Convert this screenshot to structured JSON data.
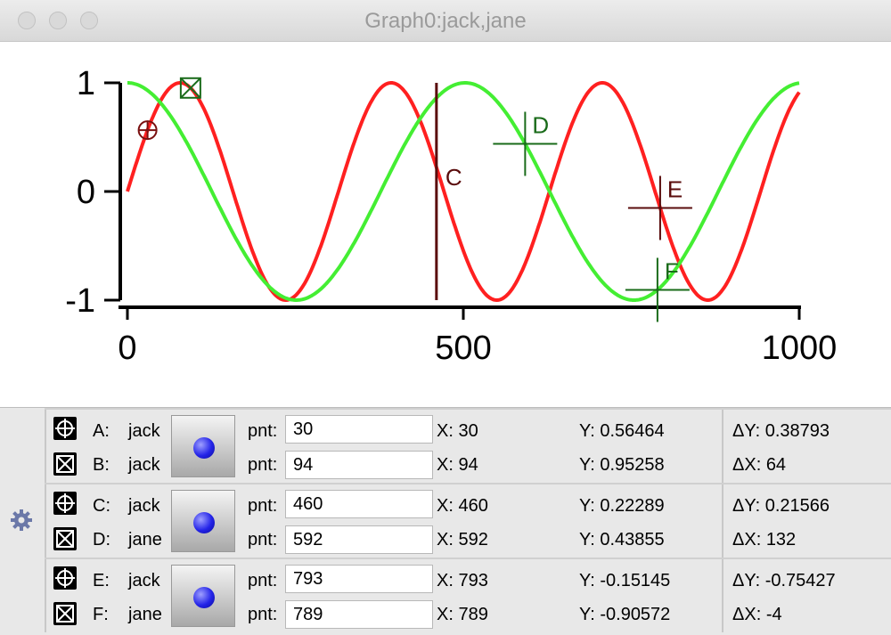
{
  "window": {
    "title": "Graph0:jack,jane"
  },
  "chart_data": {
    "type": "line",
    "x_range": [
      0,
      1000
    ],
    "y_range": [
      -1,
      1
    ],
    "x_ticks": [
      "0",
      "500",
      "1000"
    ],
    "y_ticks": [
      "1",
      "0",
      "-1"
    ],
    "series": [
      {
        "name": "jack",
        "function": "sin",
        "period": 314.16,
        "color": "#ff2020"
      },
      {
        "name": "jane",
        "function": "cos",
        "period": 502.65,
        "color": "#44ee33"
      }
    ],
    "cursors": [
      {
        "label": "A",
        "x": 30,
        "y": 0.56464,
        "style": "circle-cross",
        "color": "#7a1010"
      },
      {
        "label": "B",
        "x": 94,
        "y": 0.95258,
        "style": "box-cross",
        "color": "#1a6b1a"
      },
      {
        "label": "C",
        "x": 460,
        "y": 0.22289,
        "style": "vertical-line",
        "color": "#5a0c0c"
      },
      {
        "label": "D",
        "x": 592,
        "y": 0.43855,
        "style": "crosshair",
        "color": "#1a6b1a"
      },
      {
        "label": "E",
        "x": 793,
        "y": -0.15145,
        "style": "crosshair",
        "color": "#5a0c0c"
      },
      {
        "label": "F",
        "x": 789,
        "y": -0.90572,
        "style": "crosshair",
        "color": "#1a6b1a"
      }
    ]
  },
  "panel": {
    "groups": [
      {
        "rows": [
          {
            "letter": "A:",
            "trace": "jack",
            "pnt_label": "pnt:",
            "pnt": "30",
            "x": "X: 30",
            "y": "Y: 0.56464",
            "delta": "ΔY: 0.38793",
            "icon": "circle-cross-icon"
          },
          {
            "letter": "B:",
            "trace": "jack",
            "pnt_label": "pnt:",
            "pnt": "94",
            "x": "X: 94",
            "y": "Y: 0.95258",
            "delta": "ΔX: 64",
            "icon": "box-cross-icon"
          }
        ]
      },
      {
        "rows": [
          {
            "letter": "C:",
            "trace": "jack",
            "pnt_label": "pnt:",
            "pnt": "460",
            "x": "X: 460",
            "y": "Y: 0.22289",
            "delta": "ΔY: 0.21566",
            "icon": "circle-cross-icon"
          },
          {
            "letter": "D:",
            "trace": "jane",
            "pnt_label": "pnt:",
            "pnt": "592",
            "x": "X: 592",
            "y": "Y: 0.43855",
            "delta": "ΔX: 132",
            "icon": "box-cross-icon"
          }
        ]
      },
      {
        "rows": [
          {
            "letter": "E:",
            "trace": "jack",
            "pnt_label": "pnt:",
            "pnt": "793",
            "x": "X: 793",
            "y": "Y: -0.15145",
            "delta": "ΔY: -0.75427",
            "icon": "circle-cross-icon"
          },
          {
            "letter": "F:",
            "trace": "jane",
            "pnt_label": "pnt:",
            "pnt": "789",
            "x": "X: 789",
            "y": "Y: -0.90572",
            "delta": "ΔX: -4",
            "icon": "box-cross-icon"
          }
        ]
      }
    ]
  }
}
